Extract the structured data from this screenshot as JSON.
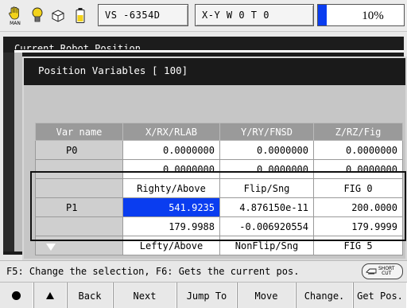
{
  "status_bar": {
    "mode_label": "MAN",
    "speed_box": "VS  -6354D",
    "coord_box": "X-Y   W 0 T 0",
    "progress_text": "10%",
    "progress_value": 0.1,
    "colors": {
      "progress_fill": "#0a3df0"
    },
    "icons": [
      "hand-icon",
      "bulb-icon",
      "cube-icon",
      "battery-icon"
    ]
  },
  "background_window": {
    "title": "Current Robot Position"
  },
  "dialog": {
    "title": "Position Variables [  100]",
    "columns": [
      "Var name",
      "X/RX/RLAB",
      "Y/RY/FNSD",
      "Z/RZ/Fig"
    ],
    "rows": [
      [
        "P0",
        "0.0000000",
        "0.0000000",
        "0.0000000"
      ],
      [
        "",
        "0.0000000",
        "0.0000000",
        "0.0000000"
      ],
      [
        "",
        "Righty/Above",
        "Flip/Sng",
        "FIG  0"
      ],
      [
        "P1",
        "541.9235",
        "4.876150e-11",
        "200.0000"
      ],
      [
        "",
        "179.9988",
        "-0.006920554",
        "179.9999"
      ],
      [
        "",
        "Lefty/Above",
        "NonFlip/Sng",
        "FIG  5"
      ]
    ],
    "selected_cell": "541.9235"
  },
  "message": {
    "text": "F5: Change the selection, F6: Gets the current pos.",
    "shortcut_label_1": "SHORT",
    "shortcut_label_2": "CUT"
  },
  "function_keys": {
    "back": "Back",
    "next": "Next",
    "jump_to": "Jump To",
    "move": "Move",
    "change": "Change.",
    "get_pos": "Get Pos."
  }
}
